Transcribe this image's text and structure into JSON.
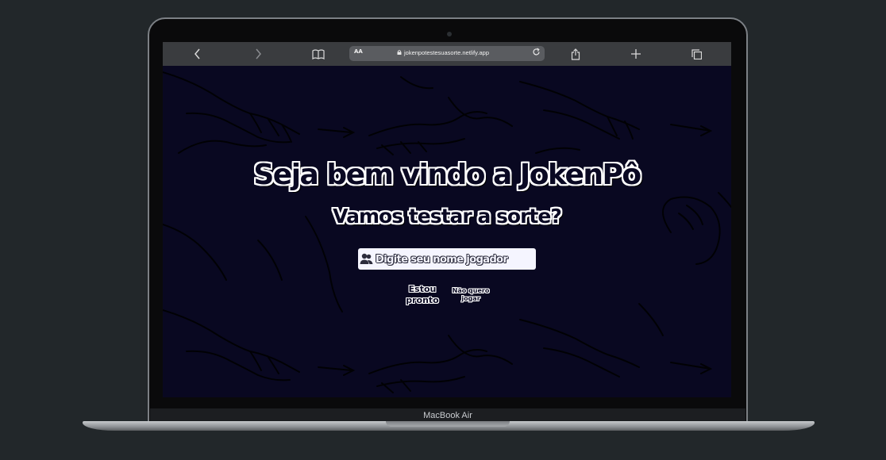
{
  "device": {
    "label": "MacBook Air"
  },
  "browser": {
    "text_size_label": "AA",
    "url": "jokenpotestesuasorte.netlify.app",
    "icons": {
      "back": "chevron-left-icon",
      "forward": "chevron-right-icon",
      "bookmarks": "book-icon",
      "reload": "reload-icon",
      "share": "share-icon",
      "new_tab": "plus-icon",
      "tabs": "tabs-icon"
    }
  },
  "page": {
    "title": "Seja bem vindo a JokenPô",
    "subtitle": "Vamos testar a sorte?",
    "name_input": {
      "placeholder": "Digite seu nome jogador",
      "value": "",
      "icon": "users-icon"
    },
    "ready_button": "Estou pronto",
    "quit_button": "Não quero jogar"
  },
  "colors": {
    "page_background": "#090821",
    "desk_background": "#22272a",
    "input_background": "#f5f5ff"
  }
}
